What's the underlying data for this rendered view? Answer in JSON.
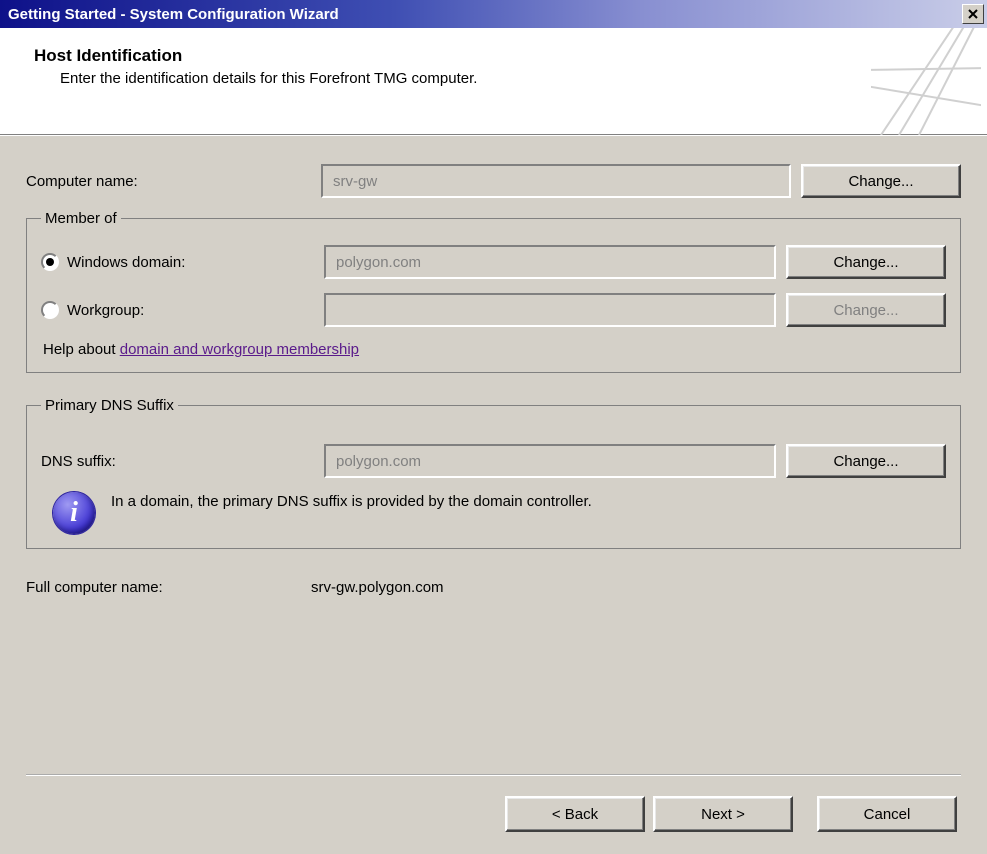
{
  "window": {
    "title": "Getting Started - System Configuration Wizard"
  },
  "header": {
    "title": "Host Identification",
    "subtitle": "Enter the identification details for this Forefront TMG computer."
  },
  "computer_name": {
    "label": "Computer name:",
    "value": "srv-gw",
    "change_btn": "Change..."
  },
  "member_of": {
    "legend": "Member of",
    "domain": {
      "label": "Windows domain:",
      "value": "polygon.com",
      "change_btn": "Change...",
      "selected": true
    },
    "workgroup": {
      "label": "Workgroup:",
      "value": "",
      "change_btn": "Change...",
      "selected": false
    },
    "help_prefix": "Help about ",
    "help_link": "domain and workgroup membership"
  },
  "dns": {
    "legend": "Primary DNS Suffix",
    "label": "DNS suffix:",
    "value": "polygon.com",
    "change_btn": "Change...",
    "info": "In a domain, the primary DNS suffix is provided by the domain controller."
  },
  "full_name": {
    "label": "Full computer name:",
    "value": "srv-gw.polygon.com"
  },
  "footer": {
    "back": "< Back",
    "next": "Next >",
    "cancel": "Cancel"
  }
}
